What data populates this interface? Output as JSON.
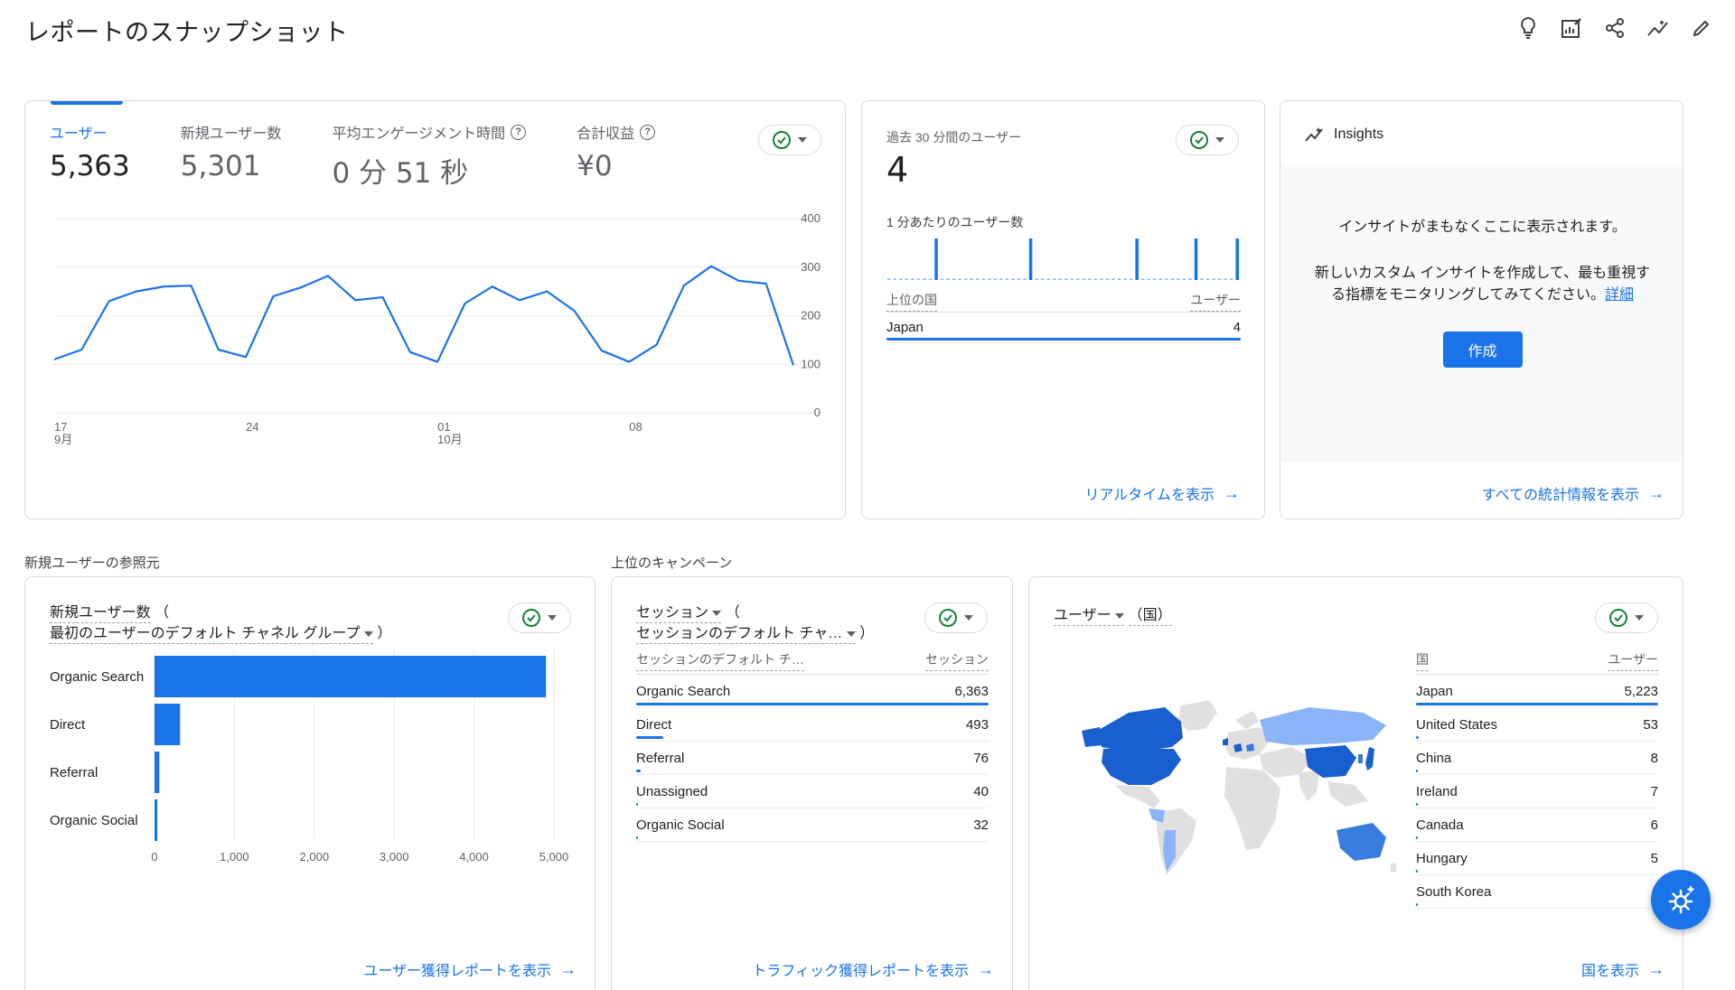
{
  "page": {
    "title": "レポートのスナップショット"
  },
  "toolbar": {
    "icons": [
      "lightbulb-icon",
      "edit-chart-icon",
      "share-icon",
      "insights-icon",
      "pencil-icon"
    ]
  },
  "overview": {
    "metrics": [
      {
        "label": "ユーザー",
        "value": "5,363",
        "help": false,
        "active": true
      },
      {
        "label": "新規ユーザー数",
        "value": "5,301",
        "help": false,
        "active": false
      },
      {
        "label": "平均エンゲージメント時間",
        "value": "0 分 51 秒",
        "help": true,
        "active": false
      },
      {
        "label": "合計収益",
        "value": "¥0",
        "help": true,
        "active": false
      }
    ],
    "help_glyph": "?"
  },
  "chart_data": [
    {
      "type": "line",
      "x": [
        "17",
        "18",
        "19",
        "20",
        "21",
        "22",
        "23",
        "24",
        "25",
        "26",
        "27",
        "28",
        "29",
        "30",
        "01",
        "02",
        "03",
        "04",
        "05",
        "06",
        "07",
        "08",
        "09",
        "10",
        "11",
        "12",
        "13",
        "14"
      ],
      "x_tick_labels": [
        {
          "index": 0,
          "label": "17",
          "sub": "9月"
        },
        {
          "index": 7,
          "label": "24",
          "sub": ""
        },
        {
          "index": 14,
          "label": "01",
          "sub": "10月"
        },
        {
          "index": 21,
          "label": "08",
          "sub": ""
        }
      ],
      "series": [
        {
          "values": [
            110,
            130,
            230,
            250,
            260,
            262,
            130,
            115,
            240,
            258,
            282,
            232,
            238,
            125,
            105,
            225,
            260,
            232,
            250,
            210,
            128,
            105,
            140,
            262,
            302,
            272,
            266,
            98
          ]
        }
      ],
      "ylim": [
        0,
        400
      ],
      "y_ticks": [
        0,
        100,
        200,
        300,
        400
      ],
      "grid": true,
      "color": "#1a73e8"
    },
    {
      "type": "bar",
      "categories": [
        "1",
        "2",
        "3",
        "4",
        "5",
        "6",
        "7",
        "8",
        "9",
        "10",
        "11",
        "12",
        "13",
        "14",
        "15",
        "16",
        "17",
        "18",
        "19",
        "20",
        "21",
        "22",
        "23",
        "24",
        "25",
        "26",
        "27",
        "28",
        "29",
        "30"
      ],
      "values": [
        0,
        0,
        0,
        0,
        0,
        0,
        0,
        0,
        1,
        0,
        0,
        0,
        0,
        0,
        0,
        0,
        0,
        0,
        0,
        0,
        0,
        0,
        0,
        0,
        1,
        0,
        0,
        0,
        0,
        0,
        0,
        0,
        0,
        0,
        0,
        0,
        0,
        0,
        0,
        0,
        0,
        0,
        1,
        0,
        0,
        0,
        0,
        0,
        0,
        0,
        0,
        0,
        1,
        0,
        0,
        0,
        0,
        0,
        0,
        1
      ],
      "ylim": [
        0,
        1
      ],
      "color": "#1a73e8"
    },
    {
      "type": "bar",
      "orientation": "horizontal",
      "categories": [
        "Organic Search",
        "Direct",
        "Referral",
        "Organic Social"
      ],
      "values": [
        4900,
        320,
        60,
        35
      ],
      "xlim": [
        0,
        5000
      ],
      "x_ticks": [
        "0",
        "1,000",
        "2,000",
        "3,000",
        "4,000",
        "5,000"
      ],
      "grid": true,
      "color": "#1a73e8"
    }
  ],
  "realtime": {
    "label": "過去 30 分間のユーザー",
    "value": "4",
    "per_minute_label": "1 分あたりのユーザー数",
    "col_country": "上位の国",
    "col_users": "ユーザー",
    "rows": [
      {
        "name": "Japan",
        "value": "4",
        "fraction": 1.0
      }
    ],
    "link": "リアルタイムを表示"
  },
  "insights": {
    "title": "Insights",
    "line1": "インサイトがまもなくここに表示されます。",
    "line2a": "新しいカスタム インサイトを作成して、最も重視す",
    "line2b": "る指標をモニタリングしてみてください。",
    "detail_link": "詳細",
    "create_button": "作成",
    "link": "すべての統計情報を表示"
  },
  "sections": {
    "new_user_source": "新規ユーザーの参照元",
    "top_campaigns": "上位のキャンペーン"
  },
  "acquisition": {
    "title_metric": "新規ユーザー数",
    "paren_open": "（",
    "title_dim": "最初のユーザーのデフォルト チャネル グループ",
    "paren_close": "）",
    "link": "ユーザー獲得レポートを表示"
  },
  "traffic": {
    "title_metric": "セッション",
    "paren_open": "（",
    "title_dim": "セッションのデフォルト チャ…",
    "paren_close": "）",
    "col_dim": "セッションのデフォルト チ…",
    "col_metric": "セッション",
    "rows": [
      {
        "name": "Organic Search",
        "value": "6,363",
        "fraction": 1.0
      },
      {
        "name": "Direct",
        "value": "493",
        "fraction": 0.078
      },
      {
        "name": "Referral",
        "value": "76",
        "fraction": 0.012
      },
      {
        "name": "Unassigned",
        "value": "40",
        "fraction": 0.006
      },
      {
        "name": "Organic Social",
        "value": "32",
        "fraction": 0.005
      }
    ],
    "link": "トラフィック獲得レポートを表示"
  },
  "countries": {
    "title_metric": "ユーザー",
    "title_dim": "（国）",
    "col_dim": "国",
    "col_metric": "ユーザー",
    "rows": [
      {
        "name": "Japan",
        "value": "5,223",
        "fraction": 1.0
      },
      {
        "name": "United States",
        "value": "53",
        "fraction": 0.01
      },
      {
        "name": "China",
        "value": "8",
        "fraction": 0.002
      },
      {
        "name": "Ireland",
        "value": "7",
        "fraction": 0.002
      },
      {
        "name": "Canada",
        "value": "6",
        "fraction": 0.001
      },
      {
        "name": "Hungary",
        "value": "5",
        "fraction": 0.001
      },
      {
        "name": "South Korea",
        "value": "",
        "fraction": 0.001
      }
    ],
    "link": "国を表示",
    "map_colors": {
      "high": "#1a5fd0",
      "mid": "#3a7be0",
      "low": "#8ab4f8",
      "none": "#e0e0e0"
    }
  }
}
